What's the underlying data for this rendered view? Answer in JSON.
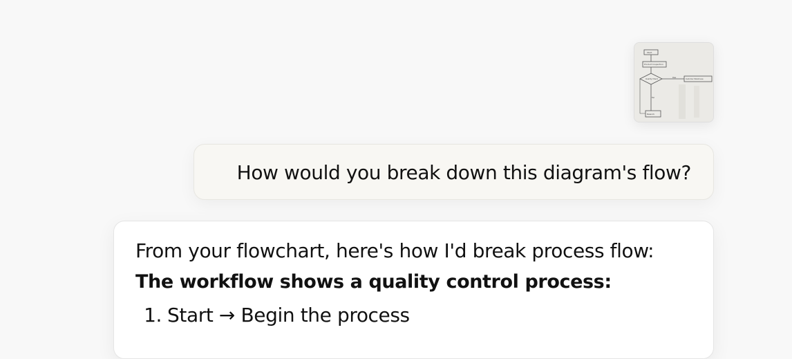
{
  "conversation": {
    "attachment": {
      "icon": "flowchart-thumbnail",
      "flowchart_labels": [
        "Start",
        "Product Inspection",
        "Quality Check",
        "Pass",
        "Fail",
        "Rework",
        "Customer Warehouse"
      ]
    },
    "user_message": "How would you break down this diagram's flow?",
    "assistant": {
      "intro": "From your flowchart, here's how I'd break process flow:",
      "heading": "The workflow shows a quality control process:",
      "steps": [
        {
          "number": "1.",
          "text": "Start → Begin the process"
        }
      ]
    }
  }
}
